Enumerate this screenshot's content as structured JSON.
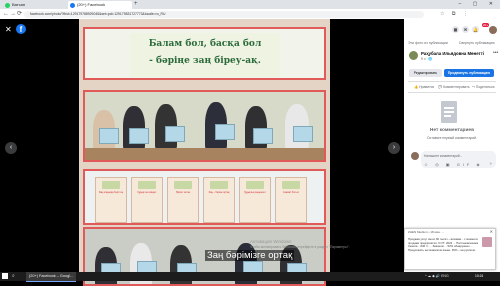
{
  "browser": {
    "tabs": [
      {
        "label": "Ватсап",
        "icon": "whatsapp-icon",
        "color": "#25d366"
      },
      {
        "label": "(20+) Facebook",
        "icon": "facebook-icon",
        "color": "#1877f2"
      }
    ],
    "new_tab_label": "+",
    "window_controls": "– ▢ ✕",
    "back": "←",
    "forward": "→",
    "reload": "⟳",
    "url": "facebook.com/photo/?fbid=129179788929045&set=pcb.129179831727773&locale=ru_RU"
  },
  "viewer": {
    "close": "✕",
    "logo": "f",
    "prev": "‹",
    "next": "›",
    "banner_lines": [
      "Балам бол, басқа бол",
      "- бәріңе заң біреу-ақ."
    ],
    "caption": "Заң бәрімізге ортақ",
    "watermark": "Активация Windows",
    "watermark_sub": "Чтобы активировать Windows, перейдите в раздел \"Параметры\"."
  },
  "side": {
    "top_icons": [
      "▦",
      "✉",
      "🔔"
    ],
    "notification_count": "20+",
    "links": [
      "Эти фото из публикации",
      "Свернуть публикацию"
    ],
    "author": "Раҳубала Ильядовна Мөнетті",
    "meta": "9 ч · 🌐",
    "more": "•••",
    "edit_label": "Редактировать",
    "promote_label": "Продвинуть публикацию",
    "actions": [
      "👍 Нравится",
      "💬 Комментировать",
      "↪ Поделиться"
    ],
    "no_comments": "Нет комментариев",
    "be_first": "Оставьте первый комментарий.",
    "comment_placeholder": "Напишите комментарий...",
    "comment_tools": "☺ ◎ ▣ GIF ◈",
    "send": "➤"
  },
  "notification": {
    "header": "ZHEN Medium • 18 мин. ...",
    "close": "✕",
    "body": "Продажа услуг иного 60 тысяч – визовая... с момента продажи предприятия. 6 ОТ: 2022 ... Постановлением Сената ...000 тг. ... Законом ... 52% обнаружено ... Продолжить на казахском языке. 36% – на русском."
  },
  "taskbar": {
    "search": "⌕",
    "app": "(20+) Facebook – Googl...",
    "tray": "^ ☁ ◆ 🔊 ENG",
    "time": "10:24"
  }
}
